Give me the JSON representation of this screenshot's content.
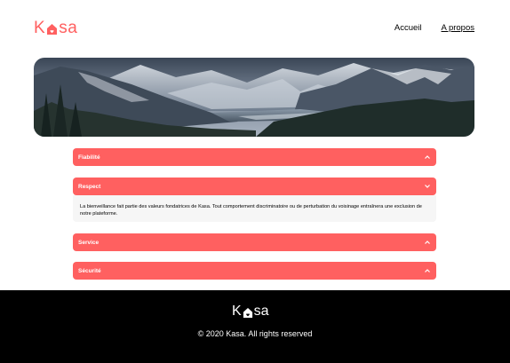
{
  "header": {
    "logo_text_a": "K",
    "logo_text_b": "sa",
    "nav": {
      "home": "Accueil",
      "about": "A propos"
    }
  },
  "banner": {
    "image": "mountain-landscape"
  },
  "accordion": [
    {
      "title": "Fiabilité",
      "expanded": false
    },
    {
      "title": "Respect",
      "expanded": true,
      "body": "La bienveillance fait partie des valeurs fondatrices de Kasa. Tout comportement discriminatoire ou de perturbation du voisinage entraînera une exclusion de notre plateforme."
    },
    {
      "title": "Service",
      "expanded": false
    },
    {
      "title": "Sécurité",
      "expanded": false
    }
  ],
  "footer": {
    "logo_text_a": "K",
    "logo_text_b": "sa",
    "copyright": "© 2020 Kasa. All rights reserved"
  },
  "colors": {
    "brand": "#FF6060",
    "panel": "#F6F6F6",
    "footer": "#000000"
  }
}
